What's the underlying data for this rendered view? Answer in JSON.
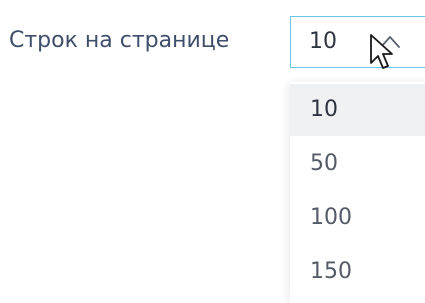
{
  "pagination": {
    "rows_label": "Строк на странице",
    "selected_value": "10",
    "options": [
      "10",
      "50",
      "100",
      "150"
    ],
    "selected_index": 0
  },
  "icons": {
    "select_toggle": "chevron-up-icon",
    "pointer": "mouse-cursor-icon"
  },
  "colors": {
    "label_text": "#3f4e6a",
    "select_border": "#6ec6e6",
    "selected_option_bg": "#f0f1f3",
    "option_text": "#555b66"
  }
}
